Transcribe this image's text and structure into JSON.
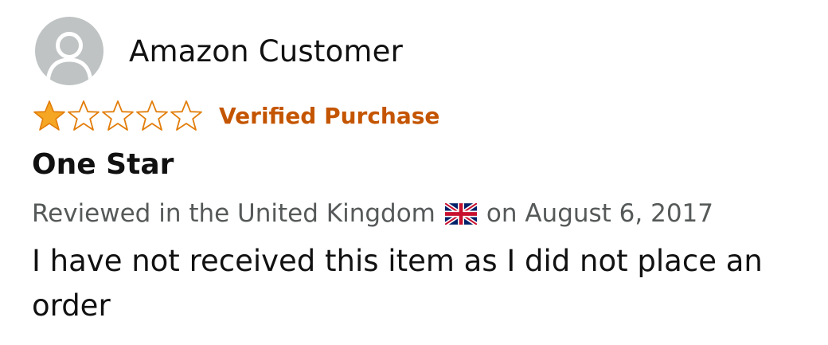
{
  "reviewer": {
    "name": "Amazon Customer",
    "avatar_icon": "default-user-icon"
  },
  "rating": {
    "value": 1,
    "max": 5,
    "star_color": "#f5a623",
    "empty_star_outline": "#e27d0a"
  },
  "badge": {
    "verified_label": "Verified Purchase",
    "color": "#c45500"
  },
  "review": {
    "title": "One Star",
    "meta_prefix": "Reviewed in the United Kingdom",
    "flag_icon": "uk-flag-icon",
    "meta_suffix": "on August 6, 2017",
    "body": "I have not received this item as I did not place an order"
  }
}
